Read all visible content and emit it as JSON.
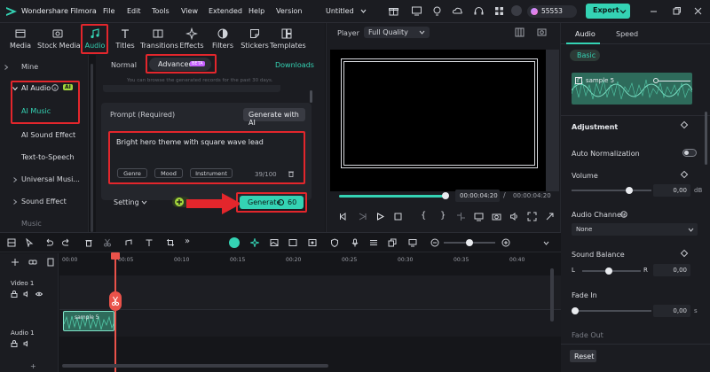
{
  "app": {
    "title": "Wondershare Filmora",
    "menu": [
      "File",
      "Edit",
      "Tools",
      "View",
      "Extended",
      "Help",
      "Version"
    ],
    "project_name": "Untitled",
    "credits": "55553",
    "export_label": "Export"
  },
  "toolbar": {
    "tabs": [
      "Media",
      "Stock Media",
      "Audio",
      "Titles",
      "Transitions",
      "Effects",
      "Filters",
      "Stickers",
      "Templates"
    ]
  },
  "leftnav": {
    "items": [
      "Mine",
      "AI Audio",
      "AI Music",
      "AI Sound Effect",
      "Text-to-Speech",
      "Universal Musi...",
      "Sound Effect",
      "Music"
    ],
    "ai_badge": "AI"
  },
  "ai_music": {
    "mode_normal": "Normal",
    "mode_advanced": "Advanced",
    "beta_badge": "BETA",
    "downloads_label": "Downloads",
    "records_note": "You can browse the generated records for the past 30 days.",
    "prompt_label": "Prompt (Required)",
    "generate_with_ai": "Generate with AI",
    "prompt_text": "Bright hero theme with square wave lead",
    "chips": [
      "Genre",
      "Mood",
      "Instrument"
    ],
    "char_count": "39/100",
    "setting_label": "Setting",
    "generate_label": "Generate",
    "generate_cost": "60"
  },
  "player": {
    "label": "Player",
    "quality": "Full Quality",
    "current_time": "00:00:04:20",
    "total_time": "00:00:04:20",
    "progress": 1.0
  },
  "right_panel": {
    "tabs": [
      "Audio",
      "Speed"
    ],
    "subtab": "Basic",
    "clip_name": "sample 5",
    "section_adjustment": "Adjustment",
    "auto_normalization": "Auto Normalization",
    "volume_label": "Volume",
    "volume_value": "0,00",
    "volume_unit": "dB",
    "volume_level": 0.5,
    "audio_channels_label": "Audio Channels",
    "audio_channels_value": "None",
    "sound_balance_label": "Sound Balance",
    "balance_left": "L",
    "balance_right": "R",
    "balance_value": "0,00",
    "fade_in_label": "Fade In",
    "fade_in_value": "0,00",
    "fade_in_unit": "s",
    "fade_out_label": "Fade Out",
    "reset_label": "Reset"
  },
  "timeline": {
    "ruler": [
      "00:00",
      "00:05",
      "00:10",
      "00:15",
      "00:20",
      "00:25",
      "00:30",
      "00:35",
      "00:40"
    ],
    "video_track": "Video 1",
    "audio_track": "Audio 1",
    "clip_label": "sample 5"
  },
  "colors": {
    "accent": "#34d3b4",
    "annotation_red": "#e3262c",
    "bg": "#141519",
    "panel": "#1b1c21"
  }
}
